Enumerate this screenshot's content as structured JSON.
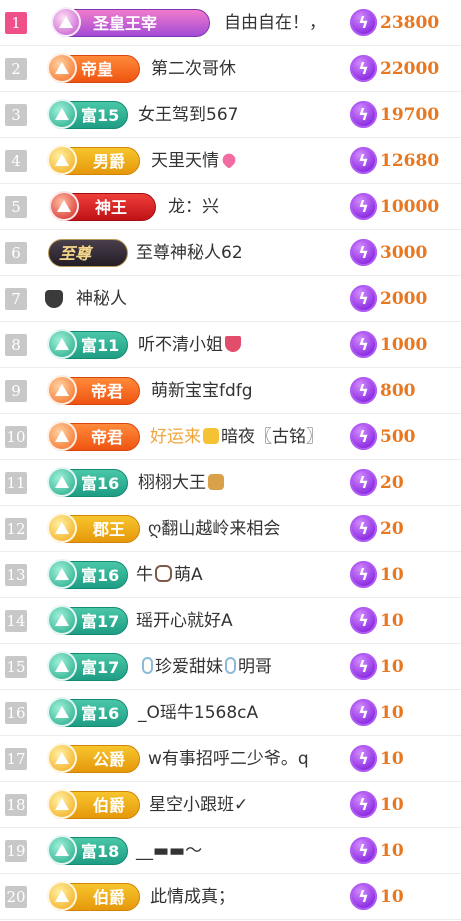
{
  "rows": [
    {
      "rank": "1",
      "badge": "圣皇王宰",
      "name": "自由自在！，",
      "score": "23800"
    },
    {
      "rank": "2",
      "badge": "帝皇",
      "name": "第二次哥休",
      "score": "22000"
    },
    {
      "rank": "3",
      "badge": "富15",
      "name": "女王驾到567",
      "score": "19700"
    },
    {
      "rank": "4",
      "badge": "男爵",
      "name": "天里天情",
      "score": "12680"
    },
    {
      "rank": "5",
      "badge": "神王",
      "name": "龙：兴",
      "score": "10000"
    },
    {
      "rank": "6",
      "badge": "至尊",
      "name": "至尊神秘人62",
      "score": "3000"
    },
    {
      "rank": "7",
      "badge": "",
      "name": "神秘人",
      "score": "2000"
    },
    {
      "rank": "8",
      "badge": "富11",
      "name": "听不清小姐",
      "score": "1000"
    },
    {
      "rank": "9",
      "badge": "帝君",
      "name": "萌新宝宝fdfg",
      "score": "800"
    },
    {
      "rank": "10",
      "badge": "帝君",
      "name_prefix": "好运来",
      "name": "暗夜〖古铭〗",
      "score": "500"
    },
    {
      "rank": "11",
      "badge": "富16",
      "name": "栩栩大王",
      "score": "20"
    },
    {
      "rank": "12",
      "badge": "郡王",
      "name": "ღ翻山越岭来相会",
      "score": "20"
    },
    {
      "rank": "13",
      "badge": "富16",
      "name_prefix": "牛",
      "name": "萌A",
      "score": "10"
    },
    {
      "rank": "14",
      "badge": "富17",
      "name": "瑶开心就好A",
      "score": "10"
    },
    {
      "rank": "15",
      "badge": "富17",
      "name_prefix": "珍爱甜妹",
      "name": "明哥",
      "score": "10"
    },
    {
      "rank": "16",
      "badge": "富16",
      "name": "_O瑶牛1568cA",
      "score": "10"
    },
    {
      "rank": "17",
      "badge": "公爵",
      "name": "w有事招呼二少爷。q",
      "score": "10"
    },
    {
      "rank": "18",
      "badge": "伯爵",
      "name": "星空小跟班✓",
      "score": "10"
    },
    {
      "rank": "19",
      "badge": "富18",
      "name": "__▬▬〜",
      "score": "10"
    },
    {
      "rank": "20",
      "badge": "伯爵",
      "name": "此情成真；",
      "score": "10"
    }
  ],
  "coin_glyph": "ϟ",
  "colors": {
    "score": "#e8771f",
    "rank_top": "#f0508a",
    "rank_default": "#c8c8c8",
    "coin": "#8a2ae0",
    "highlight_name": "#f0a53a"
  }
}
